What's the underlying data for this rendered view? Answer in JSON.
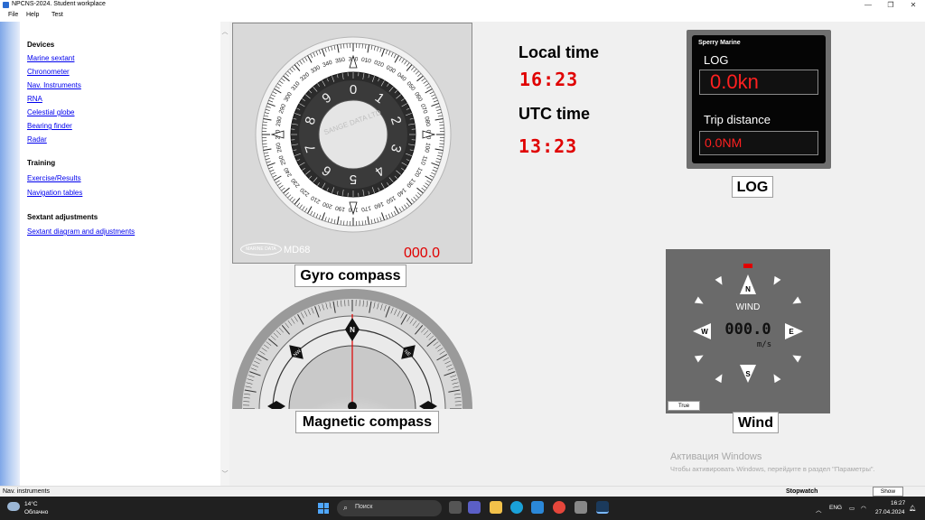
{
  "window": {
    "title": "NPCNS-2024. Student workplace",
    "minimize": "—",
    "maximize": "❐",
    "close": "✕"
  },
  "menu": [
    "File",
    "Help",
    "Test"
  ],
  "sidebar": {
    "devices": {
      "heading": "Devices",
      "items": [
        "Marine sextant",
        "Chronometer",
        "Nav. Instruments",
        "RNA",
        "Celestial globe",
        "Bearing finder",
        "Radar"
      ]
    },
    "training": {
      "heading": "Training",
      "items": [
        "Exercise/Results",
        "Navigation tables"
      ]
    },
    "sextant": {
      "heading": "Sextant adjustments",
      "items": [
        "Sextant diagram and adjustments"
      ]
    }
  },
  "gyro": {
    "caption": "Gyro compass",
    "readout": "000.0",
    "brand": "SANGE DATA LTD",
    "model": "MD68",
    "logo": "MARINE DATA",
    "outer_ticks": [
      "360",
      "010",
      "020",
      "030",
      "040",
      "050",
      "060",
      "070",
      "080",
      "090",
      "100",
      "110",
      "120",
      "130",
      "140",
      "150",
      "160",
      "170",
      "180",
      "190",
      "200",
      "210",
      "220",
      "230",
      "240",
      "250",
      "260",
      "270",
      "280",
      "290",
      "300",
      "310",
      "320",
      "330",
      "340",
      "350"
    ],
    "inner_digits": [
      "0",
      "1",
      "2",
      "3",
      "4",
      "5",
      "6",
      "7",
      "8",
      "9"
    ]
  },
  "magnetic": {
    "caption": "Magnetic compass",
    "cards": [
      "N",
      "NE",
      "NW"
    ]
  },
  "times": {
    "local_label": "Local time",
    "local_value": "16:23",
    "utc_label": "UTC time",
    "utc_value": "13:23"
  },
  "log": {
    "brand": "Sperry Marine",
    "log_label": "LOG",
    "speed": "0.0kn",
    "trip_label": "Trip distance",
    "distance": "0.0NM",
    "caption": "LOG"
  },
  "wind": {
    "caption": "Wind",
    "label": "WIND",
    "value": "000.0",
    "unit": "m/s",
    "north": "N",
    "south": "S",
    "east": "E",
    "west": "W",
    "true_button": "True"
  },
  "activation": {
    "line1": "Активация Windows",
    "line2": "Чтобы активировать Windows, перейдите в раздел \"Параметры\"."
  },
  "status": {
    "text": "Nav. instruments",
    "stopwatch": "Stopwatch",
    "show_button": "Show"
  },
  "taskbar": {
    "temp": "14°C",
    "weather": "Облачно",
    "search": "Поиск",
    "lang": "ENG",
    "time": "16:27",
    "date": "27.04.2024"
  }
}
